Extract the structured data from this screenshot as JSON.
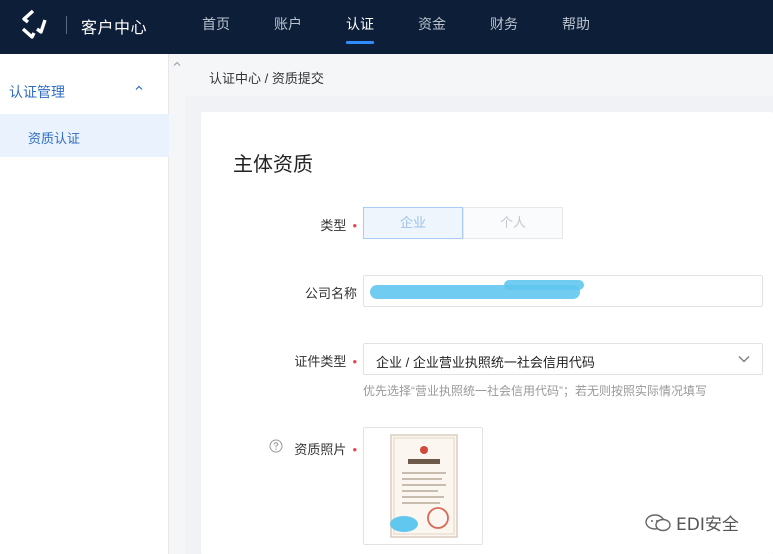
{
  "topbar": {
    "brand": "客户中心",
    "nav": [
      "首页",
      "账户",
      "认证",
      "资金",
      "财务",
      "帮助"
    ],
    "active_nav": "认证"
  },
  "sidebar": {
    "group_label": "认证管理",
    "items": [
      {
        "label": "资质认证",
        "selected": true
      }
    ]
  },
  "breadcrumb": "认证中心 / 资质提交",
  "form": {
    "title": "主体资质",
    "type": {
      "label": "类型",
      "options": [
        "企业",
        "个人"
      ],
      "selected": "企业"
    },
    "company_name": {
      "label": "公司名称",
      "value": ""
    },
    "cert_type": {
      "label": "证件类型",
      "value": "企业 / 企业营业执照统一社会信用代码",
      "hint": "优先选择“营业执照统一社会信用代码”；若无则按照实际情况填写"
    },
    "photo": {
      "label": "资质照片"
    },
    "required_mark": "•"
  },
  "watermark": "EDI安全",
  "colors": {
    "nav_bg": "#0d1e38",
    "accent": "#2f8cff",
    "sidebar_active_bg": "#e9f2fd",
    "required": "#e5484d"
  }
}
